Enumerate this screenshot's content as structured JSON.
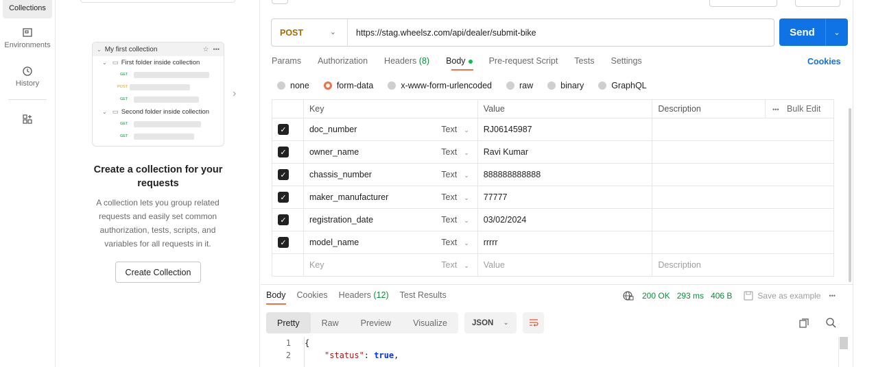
{
  "sidebar": {
    "items": [
      {
        "label": "Collections",
        "icon": "collections-icon",
        "active": true
      },
      {
        "label": "Environments",
        "icon": "environments-icon"
      },
      {
        "label": "History",
        "icon": "history-icon"
      },
      {
        "label": "",
        "icon": "apps-grid-icon"
      }
    ]
  },
  "collections_panel": {
    "illustration": {
      "collection_name": "My first collection",
      "folder1": "First folder inside collection",
      "folder2": "Second folder inside collection",
      "methods": [
        "GET",
        "POST",
        "GET",
        "GET",
        "GET"
      ]
    },
    "title": "Create a collection for your requests",
    "description": "A collection lets you group related requests and easily set common authorization, tests, scripts, and variables for all requests in it.",
    "create_button": "Create Collection"
  },
  "request": {
    "method": "POST",
    "url": "https://stag.wheelsz.com/api/dealer/submit-bike",
    "send_label": "Send",
    "tabs": [
      {
        "label": "Params"
      },
      {
        "label": "Authorization"
      },
      {
        "label": "Headers",
        "count": "(8)"
      },
      {
        "label": "Body",
        "active": true
      },
      {
        "label": "Pre-request Script"
      },
      {
        "label": "Tests"
      },
      {
        "label": "Settings"
      }
    ],
    "cookies_label": "Cookies",
    "body_types": [
      {
        "label": "none"
      },
      {
        "label": "form-data",
        "selected": true
      },
      {
        "label": "x-www-form-urlencoded"
      },
      {
        "label": "raw"
      },
      {
        "label": "binary"
      },
      {
        "label": "GraphQL"
      }
    ],
    "table": {
      "headers": {
        "key": "Key",
        "value": "Value",
        "description": "Description",
        "bulk_edit": "Bulk Edit",
        "more": "•••"
      },
      "rows": [
        {
          "key": "doc_number",
          "type": "Text",
          "value": "RJ06145987",
          "description": ""
        },
        {
          "key": "owner_name",
          "type": "Text",
          "value": "Ravi Kumar",
          "description": ""
        },
        {
          "key": "chassis_number",
          "type": "Text",
          "value": "888888888888",
          "description": ""
        },
        {
          "key": "maker_manufacturer",
          "type": "Text",
          "value": "77777",
          "description": ""
        },
        {
          "key": "registration_date",
          "type": "Text",
          "value": "03/02/2024",
          "description": ""
        },
        {
          "key": "model_name",
          "type": "Text",
          "value": "rrrrr",
          "description": ""
        }
      ],
      "placeholder": {
        "key": "Key",
        "type": "Text",
        "value": "Value",
        "description": "Description"
      }
    }
  },
  "response": {
    "tabs": [
      {
        "label": "Body",
        "active": true
      },
      {
        "label": "Cookies"
      },
      {
        "label": "Headers",
        "count": "(12)"
      },
      {
        "label": "Test Results"
      }
    ],
    "status": "200 OK",
    "time": "293 ms",
    "size": "406 B",
    "save_label": "Save as example",
    "more": "•••",
    "view_tabs": [
      {
        "label": "Pretty",
        "active": true
      },
      {
        "label": "Raw"
      },
      {
        "label": "Preview"
      },
      {
        "label": "Visualize"
      }
    ],
    "format": "JSON",
    "code": {
      "line1_no": "1",
      "line1": "{",
      "line2_no": "2",
      "line2_key": "\"status\"",
      "line2_sep": ": ",
      "line2_val": "true",
      "line2_end": ","
    }
  },
  "colors": {
    "accent": "#0f72e5",
    "status_green": "#0f8a3b",
    "radio_selected": "#f07048",
    "method_post": "#a36b00"
  }
}
